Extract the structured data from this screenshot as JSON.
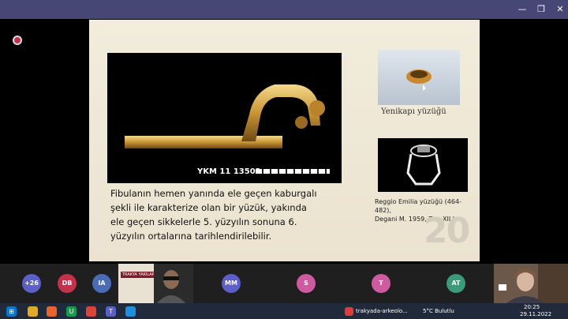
{
  "window": {
    "minimize": "—",
    "restore": "❐",
    "close": "✕"
  },
  "slide": {
    "main_caption": "YKM 11 13502",
    "description_lines": [
      "Fibulanın hemen yanında ele geçen kaburgalı",
      "şekli ile karakterize olan bir yüzük,  yakında",
      "ele geçen sikkelerle 5. yüzyılın sonuna 6.",
      "yüzyılın ortalarına tarihlendirilebilir."
    ],
    "right_caption_1": "Yenikapı yüzüğü",
    "right_caption_2_line1": "Reggio Emilia yüzüğü (464-482),",
    "right_caption_2_line2": "Degani M. 1959, Tav. XII b",
    "page_number": "20"
  },
  "participants": [
    {
      "initials": "+26",
      "color": "#5b5fc7"
    },
    {
      "initials": "DB",
      "color": "#c4314b"
    },
    {
      "initials": "IA",
      "color": "#4a6bb5"
    },
    {
      "initials": "MM",
      "color": "#5b5fc7"
    },
    {
      "initials": "S",
      "color": "#d05aa0"
    },
    {
      "initials": "T",
      "color": "#d05aa0"
    },
    {
      "initials": "AT",
      "color": "#3a9a7a"
    }
  ],
  "shared_tile": {
    "banner": "TRAKYA YAKILARI"
  },
  "taskbar": {
    "active_app": "trakyada-arkeolo...",
    "weather": "5°C  Bulutlu",
    "time": "20:25",
    "date": "29.11.2022"
  }
}
